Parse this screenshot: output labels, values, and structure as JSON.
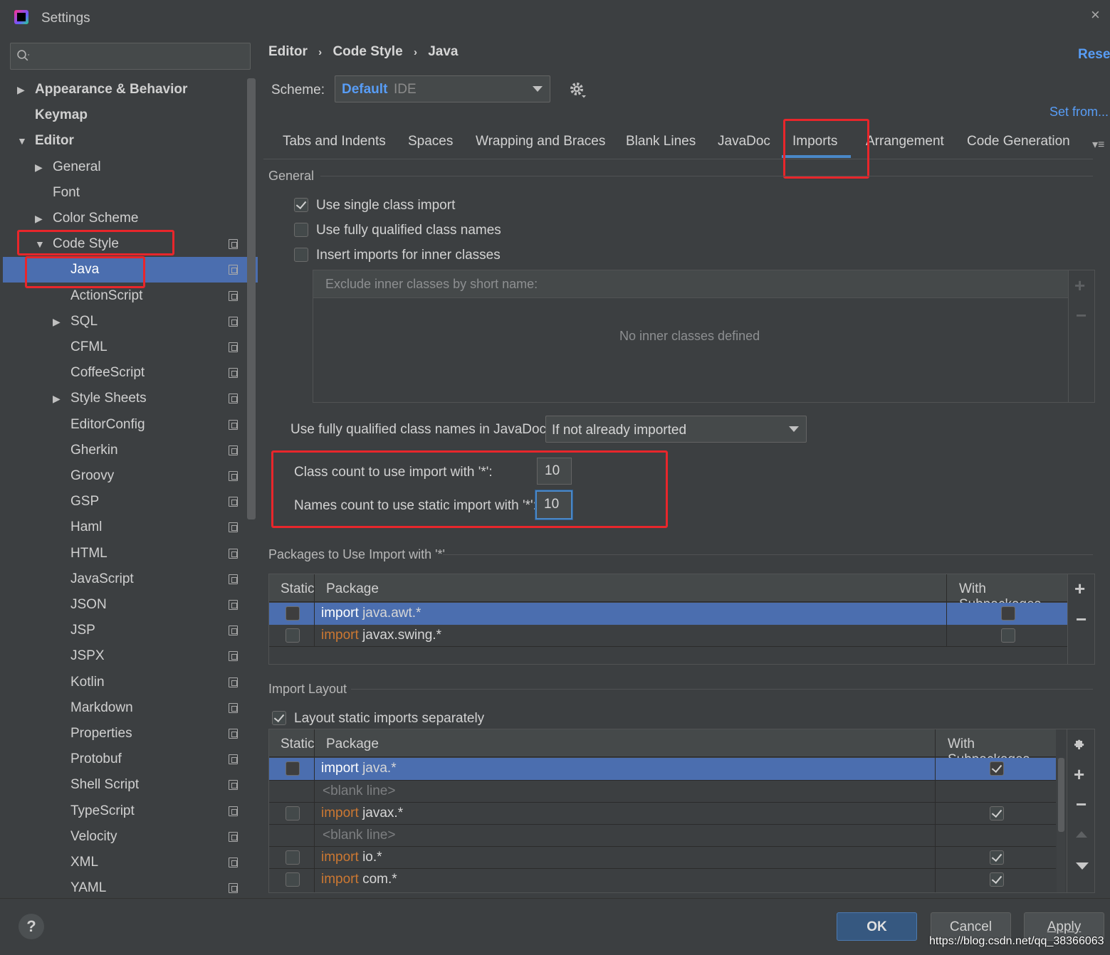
{
  "window": {
    "title": "Settings",
    "close": "×"
  },
  "search": {
    "placeholder": ""
  },
  "sidebar": {
    "items": [
      {
        "label": "Appearance & Behavior",
        "arrow": "▶"
      },
      {
        "label": "Keymap"
      },
      {
        "label": "Editor",
        "arrow": "▼"
      },
      {
        "label": "General",
        "arrow": "▶"
      },
      {
        "label": "Font"
      },
      {
        "label": "Color Scheme",
        "arrow": "▶"
      },
      {
        "label": "Code Style",
        "arrow": "▼"
      },
      {
        "label": "Java"
      },
      {
        "label": "ActionScript"
      },
      {
        "label": "SQL",
        "arrow": "▶"
      },
      {
        "label": "CFML"
      },
      {
        "label": "CoffeeScript"
      },
      {
        "label": "Style Sheets",
        "arrow": "▶"
      },
      {
        "label": "EditorConfig"
      },
      {
        "label": "Gherkin"
      },
      {
        "label": "Groovy"
      },
      {
        "label": "GSP"
      },
      {
        "label": "Haml"
      },
      {
        "label": "HTML"
      },
      {
        "label": "JavaScript"
      },
      {
        "label": "JSON"
      },
      {
        "label": "JSP"
      },
      {
        "label": "JSPX"
      },
      {
        "label": "Kotlin"
      },
      {
        "label": "Markdown"
      },
      {
        "label": "Properties"
      },
      {
        "label": "Protobuf"
      },
      {
        "label": "Shell Script"
      },
      {
        "label": "TypeScript"
      },
      {
        "label": "Velocity"
      },
      {
        "label": "XML"
      },
      {
        "label": "YAML"
      }
    ]
  },
  "breadcrumb": {
    "items": [
      "Editor",
      "Code Style",
      "Java"
    ],
    "sep": "›"
  },
  "header": {
    "reset": "Reset",
    "set_from": "Set from..."
  },
  "scheme": {
    "label": "Scheme:",
    "name": "Default",
    "type": "IDE"
  },
  "tabs": [
    "Tabs and Indents",
    "Spaces",
    "Wrapping and Braces",
    "Blank Lines",
    "JavaDoc",
    "Imports",
    "Arrangement",
    "Code Generation"
  ],
  "tabs_more": "▾≡",
  "general": {
    "title": "General",
    "options": [
      {
        "label": "Use single class import",
        "checked": true
      },
      {
        "label": "Use fully qualified class names",
        "checked": false
      },
      {
        "label": "Insert imports for inner classes",
        "checked": false
      }
    ],
    "exclude_header": "Exclude inner classes by short name:",
    "exclude_empty": "No inner classes defined",
    "javadoc_label": "Use fully qualified class names in JavaDoc:",
    "javadoc_value": "If not already imported",
    "class_count_label": "Class count to use import with '*':",
    "class_count_value": "10",
    "names_count_label": "Names count to use static import with '*':",
    "names_count_value": "10"
  },
  "packages": {
    "title": "Packages to Use Import with '*'",
    "headers": {
      "static": "Static",
      "package": "Package",
      "subpackages": "With Subpackages"
    },
    "rows": [
      {
        "kw": "import",
        "pkg": "java.awt.*",
        "static": false,
        "sub": false,
        "selected": true
      },
      {
        "kw": "import",
        "pkg": "javax.swing.*",
        "static": false,
        "sub": false,
        "selected": false
      }
    ]
  },
  "layout": {
    "title": "Import Layout",
    "static_sep_label": "Layout static imports separately",
    "static_sep_checked": true,
    "headers": {
      "static": "Static",
      "package": "Package",
      "subpackages": "With Subpackages"
    },
    "rows": [
      {
        "kw": "import",
        "pkg": "java.*",
        "sub": true,
        "selected": true
      },
      {
        "blank": "<blank line>"
      },
      {
        "kw": "import",
        "pkg": "javax.*",
        "sub": true
      },
      {
        "blank": "<blank line>"
      },
      {
        "kw": "import",
        "pkg": "io.*",
        "sub": true
      },
      {
        "kw": "import",
        "pkg": "com.*",
        "sub": true
      }
    ]
  },
  "footer": {
    "help": "?",
    "ok": "OK",
    "cancel": "Cancel",
    "apply": "Apply",
    "watermark": "https://blog.csdn.net/qq_38366063"
  },
  "colors": {
    "accent": "#4b6eaf",
    "link": "#589df6",
    "keyword": "#cc7832",
    "highlight": "#e8262b"
  }
}
